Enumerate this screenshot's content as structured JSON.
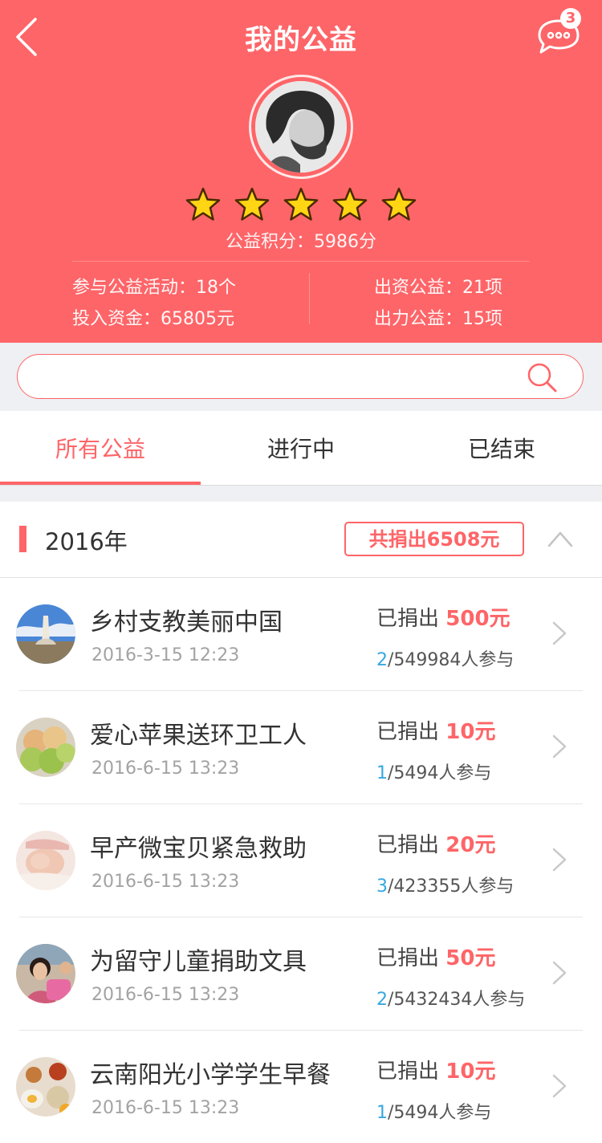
{
  "header": {
    "title": "我的公益",
    "message_count": "3",
    "score_text": "公益积分：5986分",
    "star_rating": 5,
    "stats": {
      "activities": "参与公益活动：18个",
      "funds": "投入资金：65805元",
      "money_projects": "出资公益：21项",
      "labor_projects": "出力公益：15项"
    }
  },
  "search": {
    "placeholder": "",
    "value": ""
  },
  "tabs": [
    {
      "label": "所有公益",
      "active": true
    },
    {
      "label": "进行中",
      "active": false
    },
    {
      "label": "已结束",
      "active": false
    }
  ],
  "year_section": {
    "year": "2016年",
    "total": "共捐出6508元"
  },
  "items": [
    {
      "title": "乡村支教美丽中国",
      "time": "2016-3-15 12:23",
      "donated_prefix": "已捐出 ",
      "amount": "500元",
      "my_count": "2",
      "participants": "/549984人参与"
    },
    {
      "title": "爱心苹果送环卫工人",
      "time": "2016-6-15 13:23",
      "donated_prefix": "已捐出 ",
      "amount": "10元",
      "my_count": "1",
      "participants": "/5494人参与"
    },
    {
      "title": "早产微宝贝紧急救助",
      "time": "2016-6-15 13:23",
      "donated_prefix": "已捐出 ",
      "amount": "20元",
      "my_count": "3",
      "participants": "/423355人参与"
    },
    {
      "title": "为留守儿童捐助文具",
      "time": "2016-6-15 13:23",
      "donated_prefix": "已捐出 ",
      "amount": "50元",
      "my_count": "2",
      "participants": "/5432434人参与"
    },
    {
      "title": "云南阳光小学学生早餐",
      "time": "2016-6-15 13:23",
      "donated_prefix": "已捐出 ",
      "amount": "10元",
      "my_count": "1",
      "participants": "/5494人参与"
    }
  ],
  "colors": {
    "accent": "#fe6568",
    "highlight_blue": "#35a8e0",
    "background_gray": "#eef0f3"
  },
  "icons": {
    "back": "chevron-left-icon",
    "messages": "chat-bubble-icon",
    "search": "search-icon",
    "collapse": "chevron-up-icon",
    "row_arrow": "chevron-right-icon",
    "rating": "star-icon"
  }
}
